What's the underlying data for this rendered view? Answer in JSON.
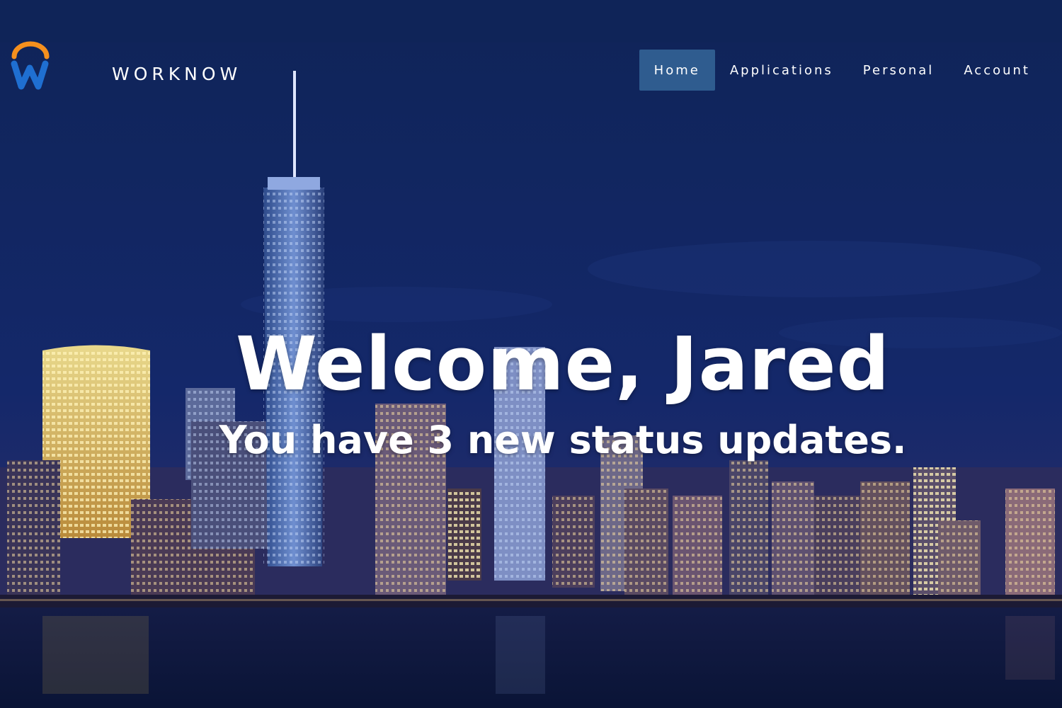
{
  "brand": {
    "name": "WORKNOW",
    "logo_icon": "workday-w-logo",
    "logo_colors": {
      "arc": "#f5901e",
      "letter": "#1f6fd1"
    }
  },
  "nav": {
    "items": [
      {
        "label": "Home",
        "active": true
      },
      {
        "label": "Applications",
        "active": false
      },
      {
        "label": "Personal",
        "active": false
      },
      {
        "label": "Account",
        "active": false
      }
    ],
    "active_color": "#2f5c8f"
  },
  "hero": {
    "headline": "Welcome, Jared",
    "subline": "You have 3 new status updates.",
    "background": "night-city-skyline-image"
  },
  "colors": {
    "sky": "#0f2458",
    "water": "#0a1638",
    "text": "#ffffff"
  }
}
